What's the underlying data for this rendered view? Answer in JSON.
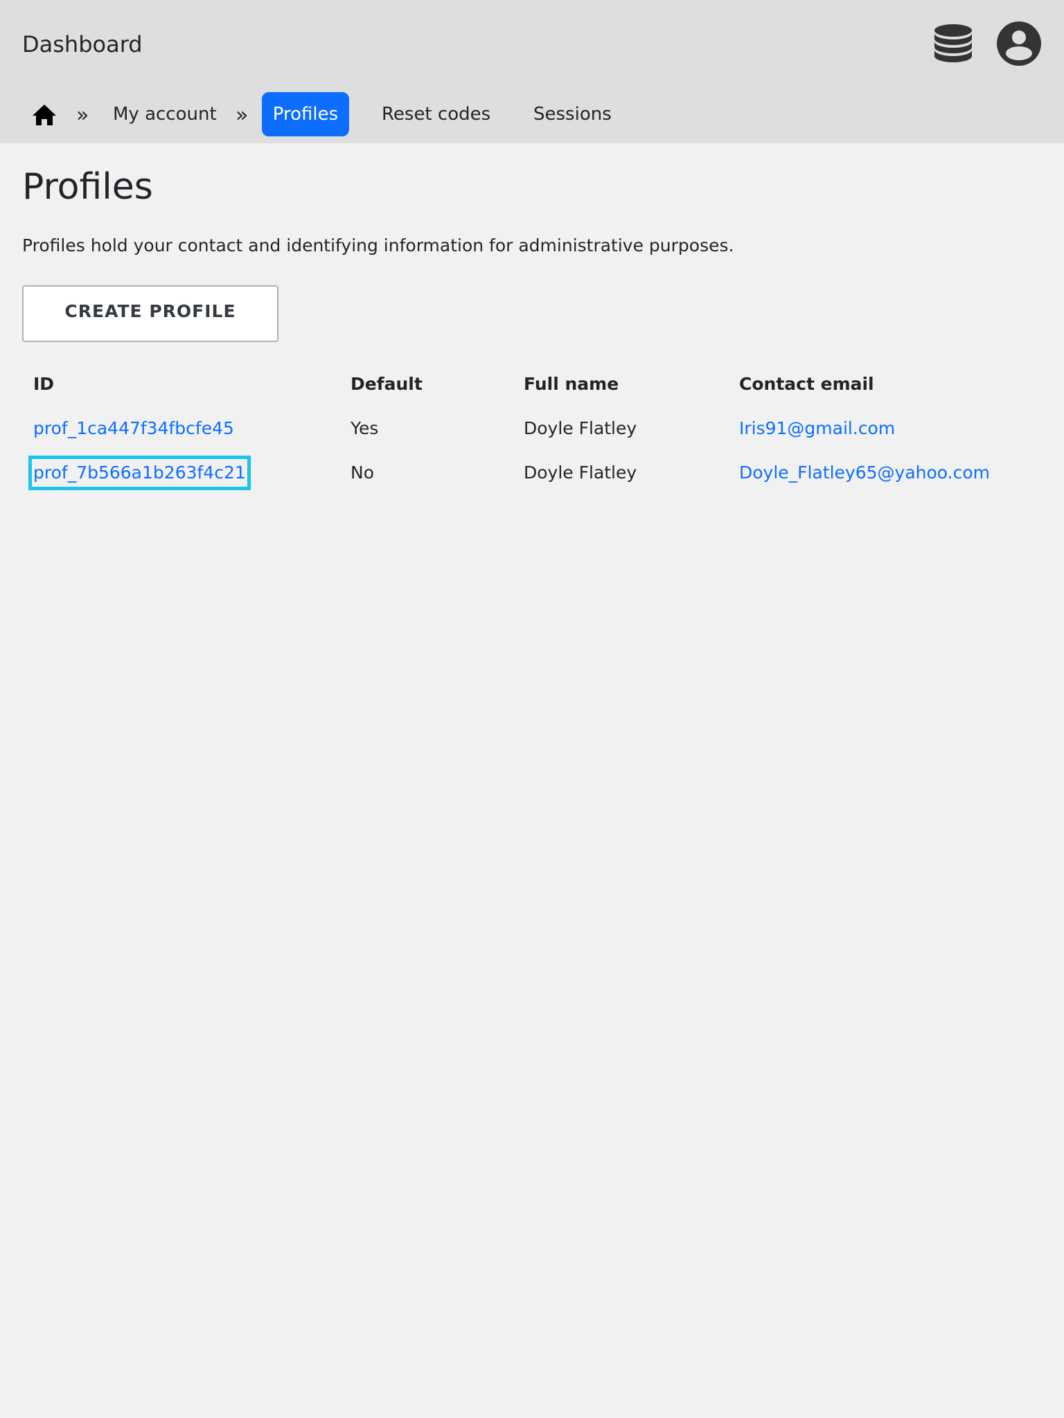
{
  "header": {
    "app_title": "Dashboard"
  },
  "nav": {
    "separator": "»",
    "items": [
      {
        "label": "My account"
      },
      {
        "label": "Profiles",
        "active": true
      },
      {
        "label": "Reset codes"
      },
      {
        "label": "Sessions"
      }
    ]
  },
  "page": {
    "title": "Profiles",
    "description": "Profiles hold your contact and identifying information for administrative purposes.",
    "create_button": "CREATE PROFILE"
  },
  "table": {
    "columns": [
      "ID",
      "Default",
      "Full name",
      "Contact email"
    ],
    "rows": [
      {
        "id": "prof_1ca447f34fbcfe45",
        "default": "Yes",
        "full_name": "Doyle Flatley",
        "email": "Iris91@gmail.com"
      },
      {
        "id": "prof_7b566a1b263f4c21",
        "default": "No",
        "full_name": "Doyle Flatley",
        "email": "Doyle_Flatley65@yahoo.com"
      }
    ]
  },
  "icons": {
    "header": [
      "database-icon",
      "user-account-icon"
    ],
    "nav": [
      "home-icon"
    ]
  },
  "colors": {
    "header_bg": "#dedede",
    "page_bg": "#f1f1f1",
    "accent": "#0d6efd",
    "link": "#0d6efd",
    "focus_outline": "#1cc6ea"
  }
}
